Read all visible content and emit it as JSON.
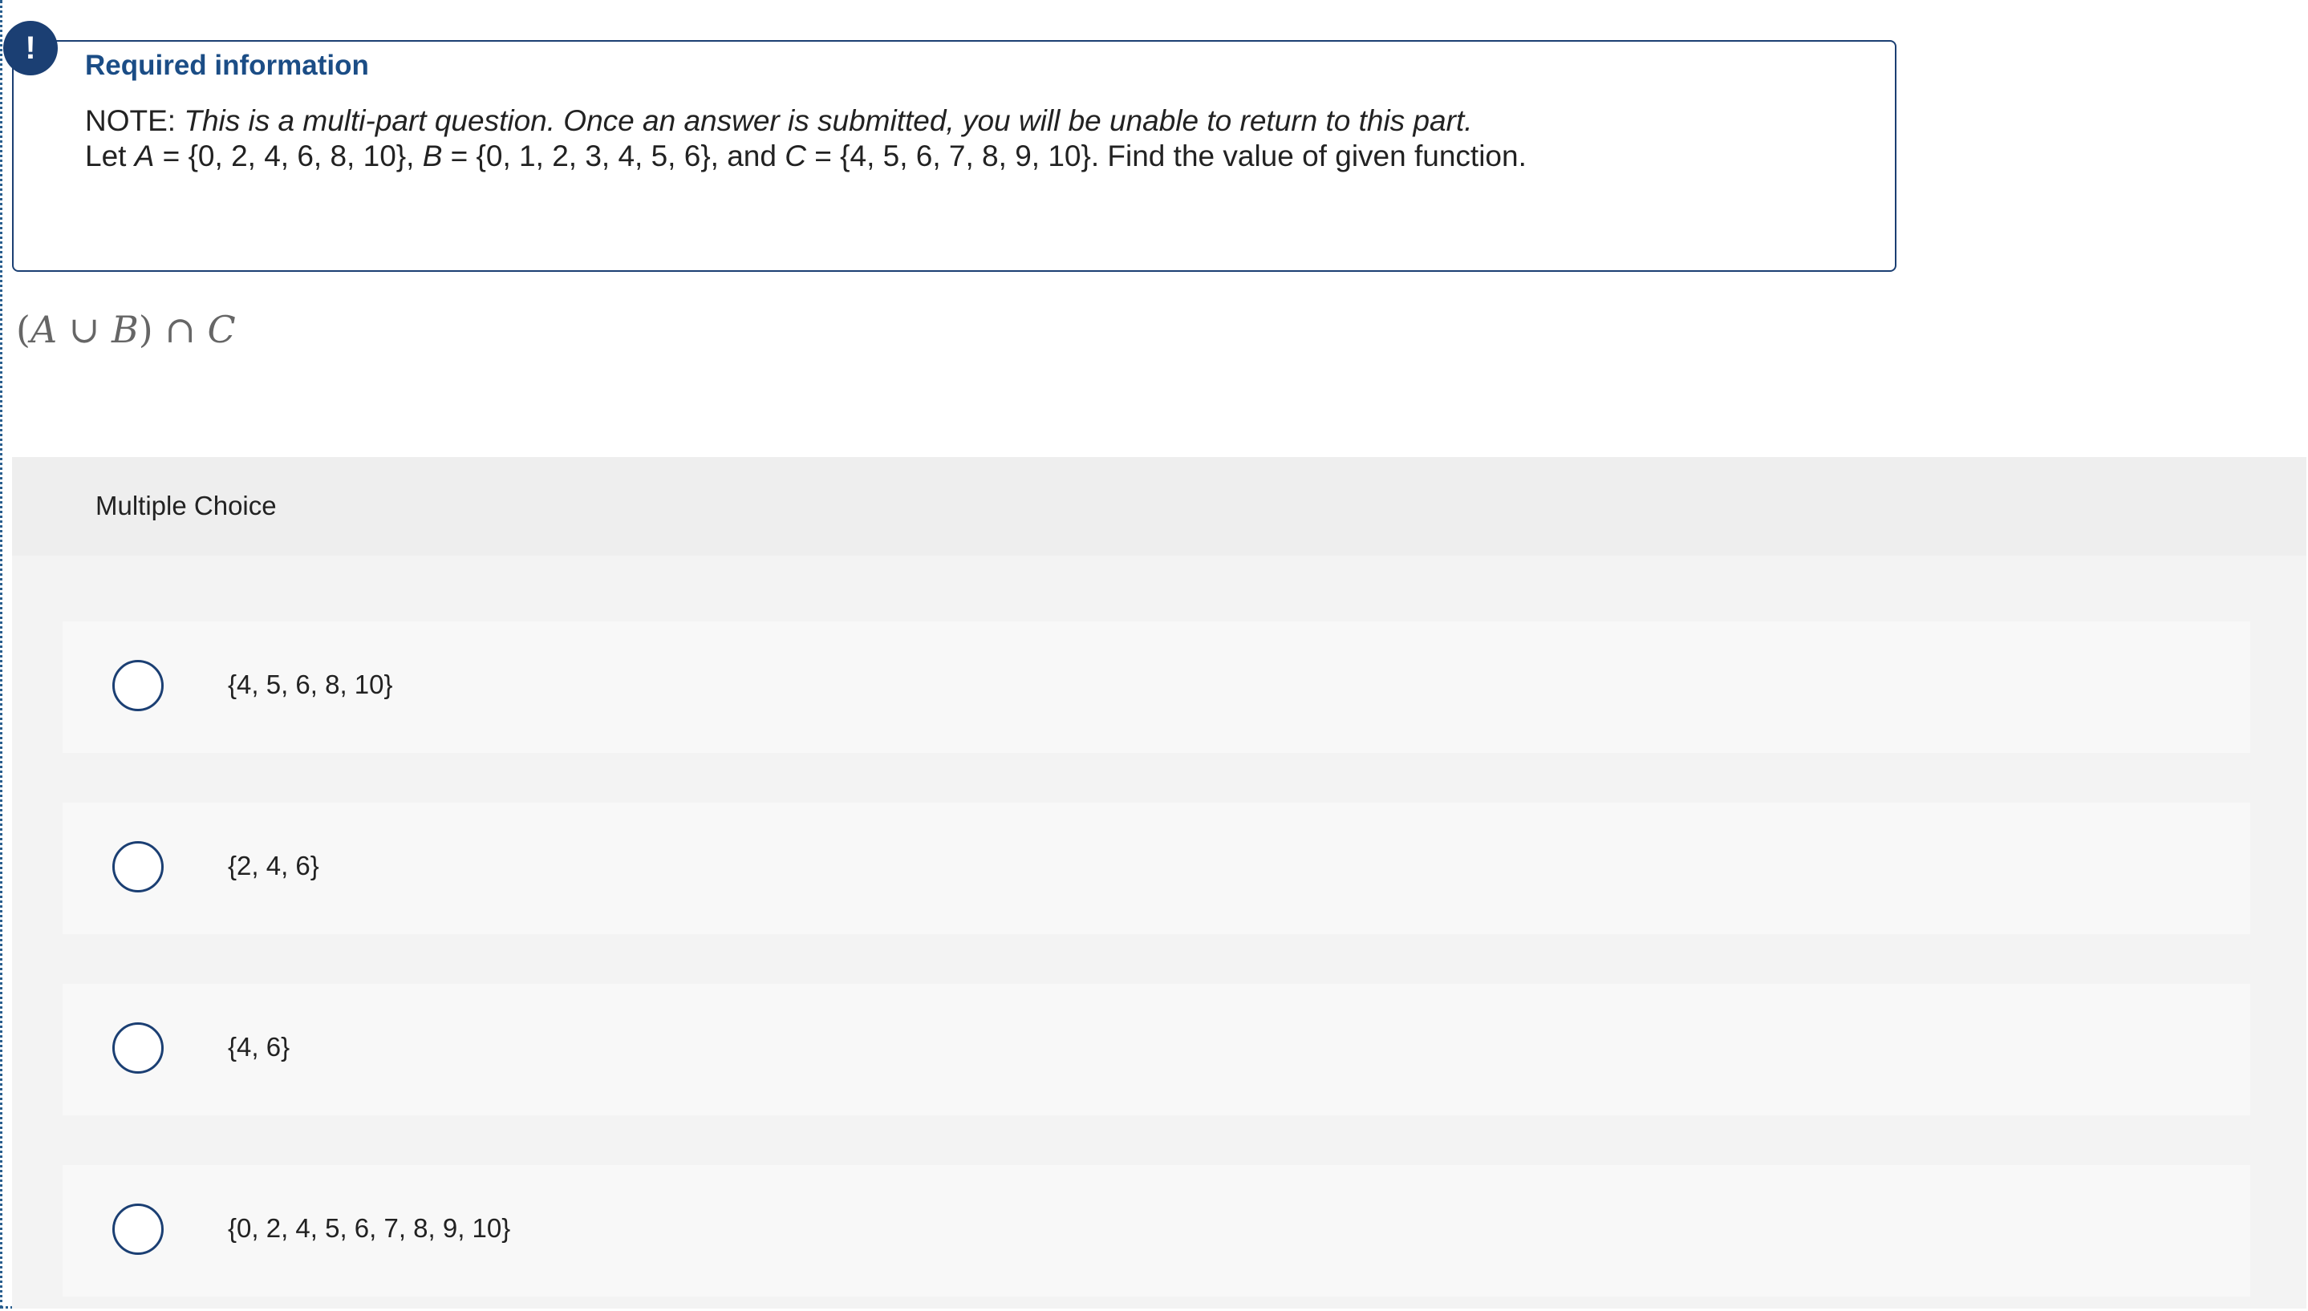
{
  "required_info": {
    "icon": "exclamation-icon",
    "icon_glyph": "!",
    "title": "Required information",
    "note_prefix": "NOTE: ",
    "note_text": "This is a multi-part question. Once an answer is submitted, you will be unable to return to this part.",
    "let_word": "Let ",
    "var_a": "A",
    "set_a": " = {0, 2, 4, 6, 8, 10}, ",
    "var_b": "B",
    "set_b": " = {0, 1, 2, 3, 4, 5, 6}, and ",
    "var_c": "C",
    "set_c": " = {4, 5, 6, 7, 8, 9, 10}. Find the value of given function."
  },
  "expression": {
    "open": "(",
    "a": "A",
    "union": " ∪ ",
    "b": "B",
    "close": ") ∩ ",
    "c": "C"
  },
  "multiple_choice": {
    "title": "Multiple Choice",
    "options": [
      {
        "label": "{4, 5, 6, 8, 10}"
      },
      {
        "label": "{2, 4, 6}"
      },
      {
        "label": "{4, 6}"
      },
      {
        "label": "{0, 2, 4, 5, 6, 7, 8, 9, 10}"
      }
    ]
  },
  "colors": {
    "accent": "#1b3f73",
    "title_blue": "#1b4d86",
    "panel_bg": "#f3f3f3",
    "option_bg": "#f8f8f8"
  }
}
